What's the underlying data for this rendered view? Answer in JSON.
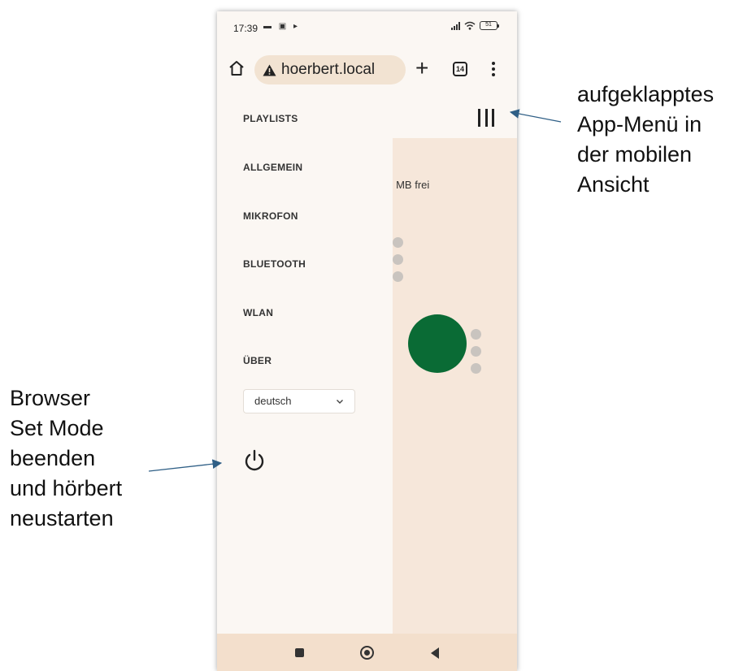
{
  "statusbar": {
    "time": "17:39",
    "notification_icons": "▬ ▣ ▸",
    "battery": "51",
    "icons": [
      "signal-icon",
      "wifi-icon",
      "battery-icon"
    ]
  },
  "browser": {
    "url": "hoerbert.local",
    "tab_count": "14",
    "plus_label": "+",
    "icons": [
      "home-icon",
      "warning-icon",
      "new-tab-icon",
      "tabs-icon",
      "more-icon"
    ]
  },
  "page": {
    "free_text": "' MB frei",
    "accent_color": "#0a6b35"
  },
  "drawer": {
    "items": [
      {
        "label": "PLAYLISTS"
      },
      {
        "label": "ALLGEMEIN"
      },
      {
        "label": "MIKROFON"
      },
      {
        "label": "BLUETOOTH"
      },
      {
        "label": "WLAN"
      },
      {
        "label": "ÜBER"
      }
    ],
    "language": {
      "selected": "deutsch"
    },
    "icons": [
      "hamburger-icon",
      "chevron-down-icon",
      "power-icon"
    ]
  },
  "annotations": {
    "right": [
      "aufgeklapptes",
      "App-Menü in",
      "der mobilen",
      "Ansicht"
    ],
    "left": [
      "Browser",
      "Set Mode",
      "beenden",
      "und hörbert",
      "neustarten"
    ]
  },
  "colors": {
    "page_background": "#f6e7da",
    "drawer_background": "#fbf7f3",
    "navbar_background": "#f3dfcc",
    "status_dot": "#c9c4bf",
    "annotation_arrow": "#2f5f86"
  }
}
